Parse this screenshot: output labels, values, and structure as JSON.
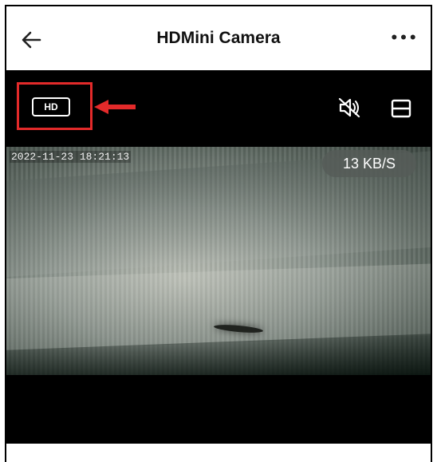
{
  "header": {
    "title": "HDMini Camera",
    "back_icon": "arrow-left-icon",
    "more_icon": "more-dots-icon",
    "more_label": "•••"
  },
  "toolbar": {
    "quality_label": "HD",
    "mute_icon": "speaker-muted-icon",
    "layout_icon": "layout-toggle-icon",
    "highlight_color": "#e32a2a",
    "background": "#000000"
  },
  "video": {
    "timestamp": "2022-11-23 18:21:13",
    "bitrate": "13 KB/S"
  }
}
